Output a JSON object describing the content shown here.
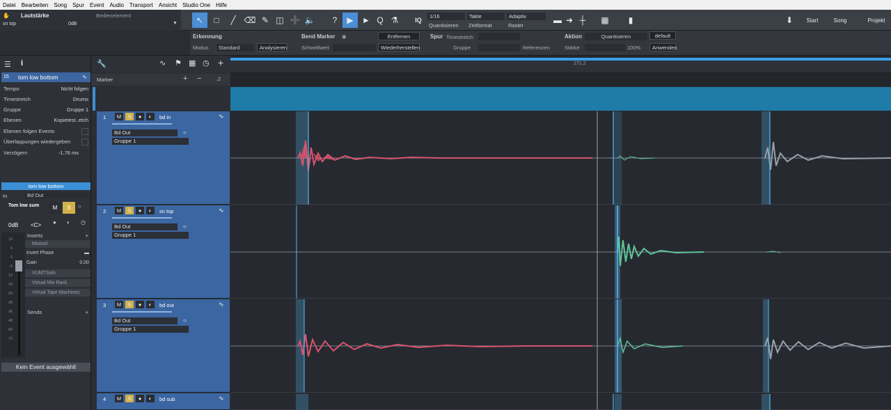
{
  "menu": [
    "Datei",
    "Bearbeiten",
    "Song",
    "Spur",
    "Event",
    "Audio",
    "Transport",
    "Ansicht",
    "Studio One",
    "Hilfe"
  ],
  "toolbar": {
    "param_label": "Lautstärke",
    "param_track": "sn top",
    "param_value": "0dB",
    "bedienelement": "Bedienelement",
    "quantize_value": "1/16",
    "quantize_label": "Quantisieren",
    "timeformat_value": "Takte",
    "timeformat_label": "Zeitformat",
    "grid_value": "Adaptiv",
    "grid_label": "Raster",
    "start": "Start",
    "song": "Song",
    "projekt": "Projekt",
    "iq": "IQ"
  },
  "inspector": {
    "erkennung": "Erkennung",
    "modus_label": "Modus",
    "modus_value": "Standard",
    "analysieren": "Analysieren",
    "bend_marker": "Bend Marker",
    "schwellwert": "Schwellwert",
    "entfernen": "Entfernen",
    "wiederherstellen": "Wiederherstellen",
    "spur": "Spur",
    "timestretch": "Timestretch",
    "gruppe": "Gruppe",
    "referenzen": "Referenzen",
    "aktion": "Aktion",
    "quantisieren": "Quantisieren",
    "default": "default",
    "staerke": "Stärke",
    "staerke_value": "100%",
    "anwenden": "Anwenden"
  },
  "left": {
    "track_no": "15",
    "track_name": "tom low bottom",
    "rows": [
      {
        "label": "Tempo",
        "value": "Nicht folgen"
      },
      {
        "label": "Timestretch",
        "value": "Drums"
      },
      {
        "label": "Gruppe",
        "value": "Gruppe 1"
      },
      {
        "label": "Ebenen",
        "value": "Kopietest..etch"
      },
      {
        "label": "Ebenen folgen Events",
        "value": ""
      },
      {
        "label": "Überlappungen wiedergeben",
        "value": ""
      },
      {
        "label": "Verzögern",
        "value": "-1.76 ms"
      }
    ],
    "channel_name": "tom low bottom",
    "in_label": "In",
    "in_value": "Bd Out",
    "channel_short": "Tom low sum",
    "vol": "0dB",
    "pan": "<C>",
    "inserts": "Inserts",
    "plugins": [
      "Mixtool",
      "VUMTSolo",
      "Virtual Mix Rack",
      "Virtual Tape Machines"
    ],
    "invert_phase": "Invert Phase",
    "gain": "Gain",
    "gain_value": "0.00",
    "sends": "Sends",
    "no_event": "Kein Event ausgewählt",
    "meter_scale": [
      "12",
      "6",
      "0",
      "-6",
      "-12",
      "-18",
      "-24",
      "-30",
      "-36",
      "-48",
      "-60",
      "-72"
    ]
  },
  "trackhead": {
    "marker": "Marker",
    "tracks": [
      {
        "num": "1",
        "name": "bd in",
        "out": "Bd Out",
        "group": "Gruppe 1"
      },
      {
        "num": "2",
        "name": "sn top",
        "out": "Bd Out",
        "group": "Gruppe 1"
      },
      {
        "num": "3",
        "name": "bd out",
        "out": "Bd Out",
        "group": "Gruppe 1"
      },
      {
        "num": "4",
        "name": "bd sub",
        "out": "",
        "group": ""
      }
    ],
    "m": "M",
    "s": "S"
  },
  "ruler": {
    "label": "171.2"
  },
  "colors": {
    "accent": "#3aa0e6",
    "track": "#3b66a1",
    "red_wave": "#d9536e",
    "green_wave": "#5fc49a",
    "gray_wave": "#9aa0a8",
    "solo": "#d2b24a"
  }
}
